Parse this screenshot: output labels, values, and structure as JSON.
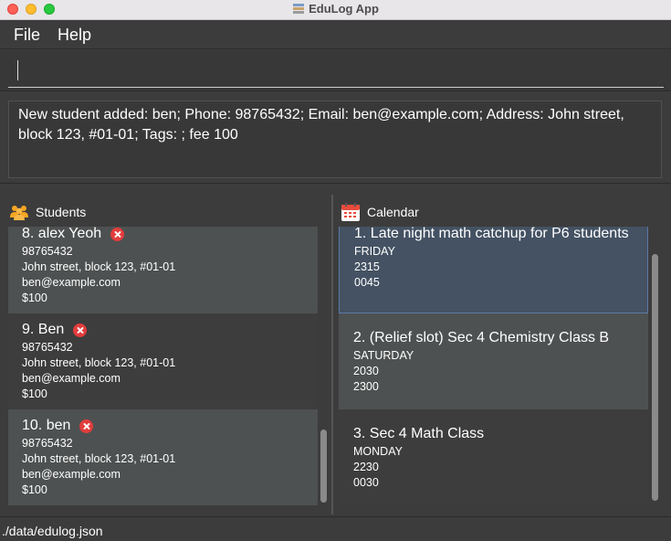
{
  "window": {
    "title": "EduLog App"
  },
  "menu": {
    "file": "File",
    "help": "Help"
  },
  "command": {
    "value": "",
    "placeholder": ""
  },
  "result": {
    "text": "New student added: ben; Phone: 98765432; Email: ben@example.com; Address: John street, block 123, #01-01; Tags: ; fee 100"
  },
  "students": {
    "header": "Students",
    "icon": "students-icon",
    "items": [
      {
        "name": "8. alex Yeoh",
        "phone": "98765432",
        "address": "John street, block 123, #01-01",
        "email": "ben@example.com",
        "fee": "$100"
      },
      {
        "name": "9. Ben",
        "phone": "98765432",
        "address": "John street, block 123, #01-01",
        "email": "ben@example.com",
        "fee": "$100"
      },
      {
        "name": "10. ben",
        "phone": "98765432",
        "address": "John street, block 123, #01-01",
        "email": "ben@example.com",
        "fee": "$100"
      }
    ]
  },
  "calendar": {
    "header": "Calendar",
    "icon": "calendar-icon",
    "items": [
      {
        "title": "1. Late night math catchup for P6 students",
        "day": "FRIDAY",
        "start": "2315",
        "end": "0045"
      },
      {
        "title": "2. (Relief slot) Sec 4 Chemistry Class B",
        "day": "SATURDAY",
        "start": "2030",
        "end": "2300"
      },
      {
        "title": "3. Sec 4 Math Class",
        "day": "MONDAY",
        "start": "2230",
        "end": "0030"
      }
    ]
  },
  "status": {
    "path": "./data/edulog.json"
  },
  "colors": {
    "background": "#3c3c3c",
    "card_light": "#4e5151",
    "card_dark": "#3d3d3d",
    "selected": "#445263",
    "delete": "#e23c3c"
  }
}
